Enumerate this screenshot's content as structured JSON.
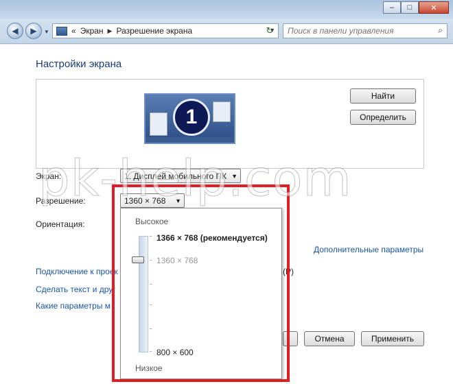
{
  "window": {
    "minimize_glyph": "–",
    "maximize_glyph": "□",
    "close_glyph": "✕"
  },
  "nav": {
    "back_glyph": "◀",
    "forward_glyph": "▶",
    "history_glyph": "▼",
    "breadcrumb_sep": "«",
    "breadcrumb": [
      "Экран",
      "Разрешение экрана"
    ],
    "arrow": "▶",
    "dropdown_glyph": "▼",
    "refresh_glyph": "↻",
    "search_placeholder": "Поиск в панели управления",
    "search_glyph": "⌕"
  },
  "main": {
    "title": "Настройки экрана",
    "monitor_number": "1",
    "find_button": "Найти",
    "identify_button": "Определить",
    "display_label": "Экран:",
    "display_value": "1. Дисплей мобильного ПК",
    "resolution_label": "Разрешение:",
    "resolution_value": "1360 × 768",
    "orientation_label": "Ориентация:",
    "advanced_link": "Дополнительные параметры",
    "links": [
      "Подключение к проек",
      "Сделать текст и друг",
      "Какие параметры м"
    ],
    "link_tail": "(P)",
    "cancel_button": "Отмена",
    "apply_button": "Применить"
  },
  "dropdown": {
    "high_label": "Высокое",
    "low_label": "Низкое",
    "options": {
      "top": "1366 × 768 (рекомендуется)",
      "current": "1360 × 768",
      "bottom": "800 × 600"
    },
    "caret": "▼"
  },
  "watermark": "pk-help.com"
}
